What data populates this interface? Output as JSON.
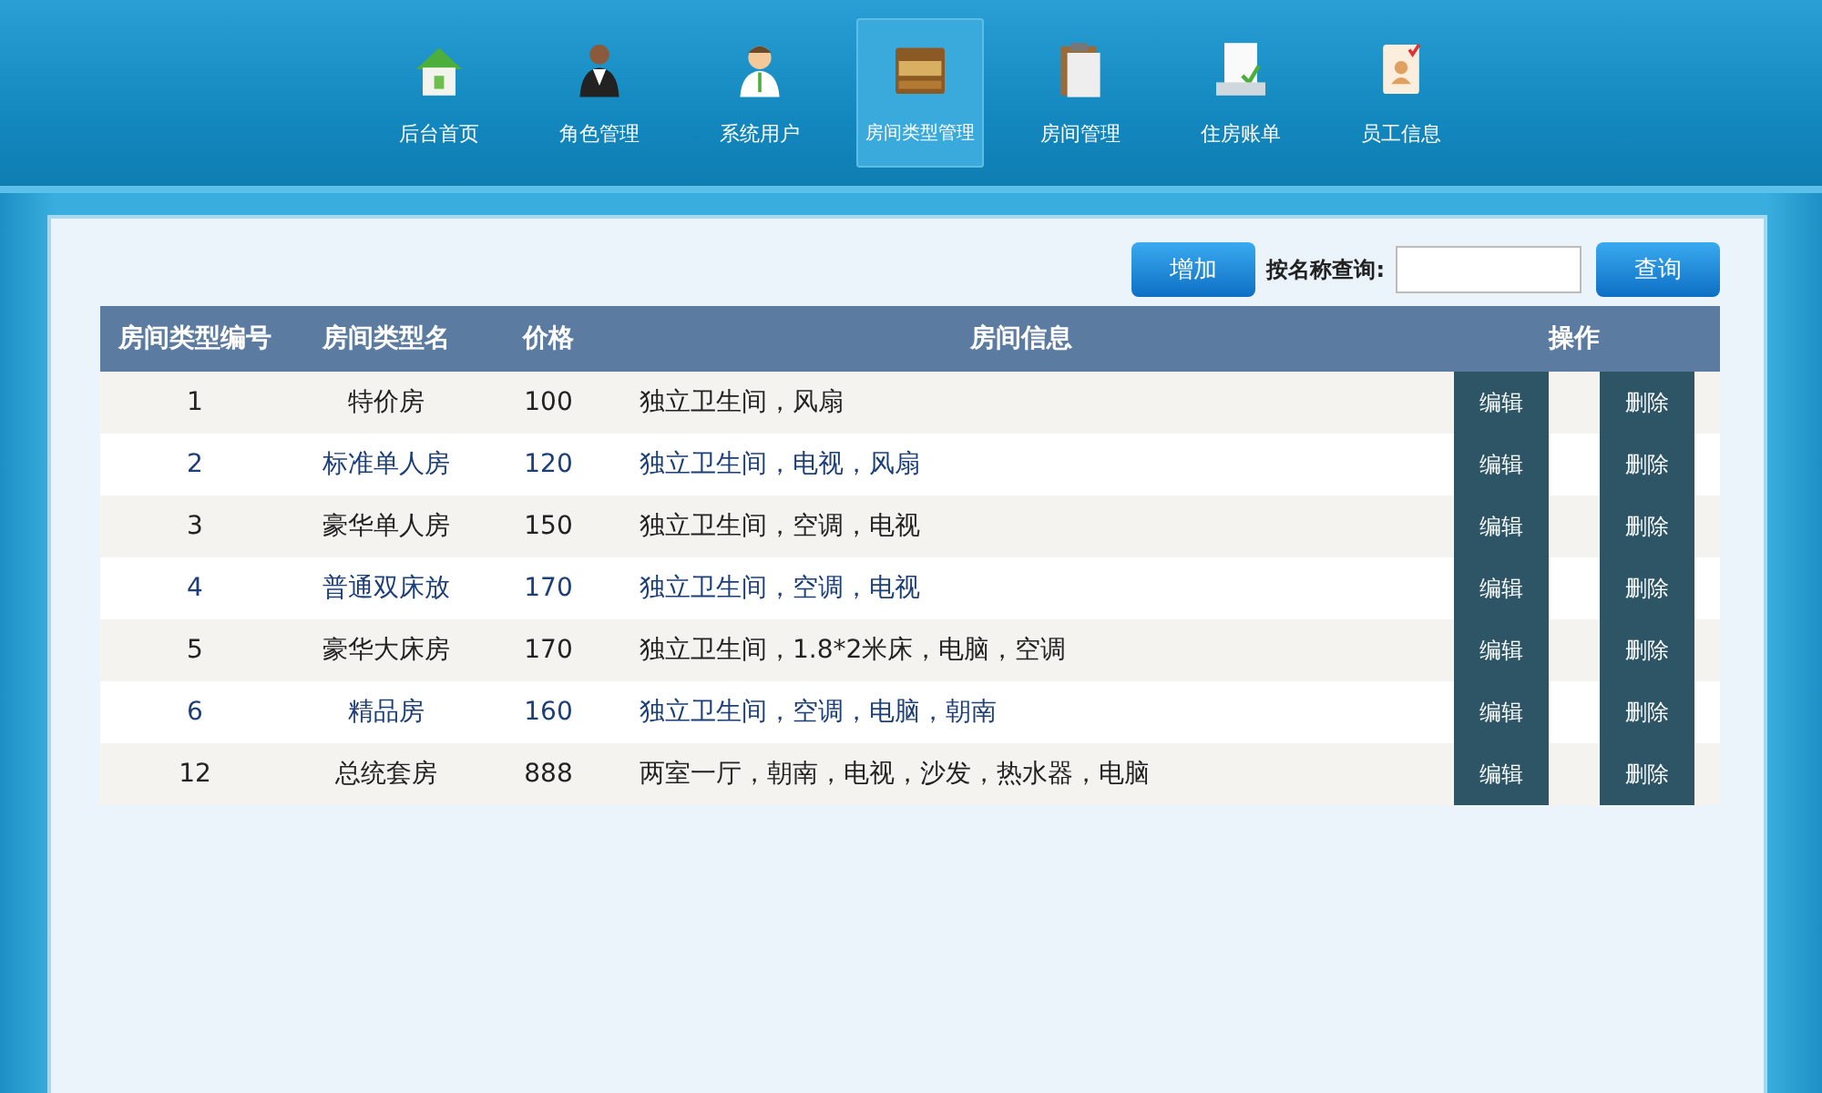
{
  "nav": [
    {
      "label": "后台首页",
      "selected": false
    },
    {
      "label": "角色管理",
      "selected": false
    },
    {
      "label": "系统用户",
      "selected": false
    },
    {
      "label": "房间类型管理",
      "selected": true
    },
    {
      "label": "房间管理",
      "selected": false
    },
    {
      "label": "住房账单",
      "selected": false
    },
    {
      "label": "员工信息",
      "selected": false
    }
  ],
  "toolbar": {
    "add_button": "增加",
    "search_label": "按名称查询:",
    "search_button": "查询"
  },
  "table": {
    "columns": [
      "房间类型编号",
      "房间类型名",
      "价格",
      "房间信息",
      "操作"
    ],
    "rows": [
      {
        "id": "1",
        "name": "特价房",
        "price": "100",
        "info": "独立卫生间，风扇",
        "edit": "编辑",
        "delete": "删除"
      },
      {
        "id": "2",
        "name": "标准单人房",
        "price": "120",
        "info": "独立卫生间，电视，风扇",
        "edit": "编辑",
        "delete": "删除"
      },
      {
        "id": "3",
        "name": "豪华单人房",
        "price": "150",
        "info": "独立卫生间，空调，电视",
        "edit": "编辑",
        "delete": "删除"
      },
      {
        "id": "4",
        "name": "普通双床放",
        "price": "170",
        "info": "独立卫生间，空调，电视",
        "edit": "编辑",
        "delete": "删除"
      },
      {
        "id": "5",
        "name": "豪华大床房",
        "price": "170",
        "info": "独立卫生间，1.8*2米床，电脑，空调",
        "edit": "编辑",
        "delete": "删除"
      },
      {
        "id": "6",
        "name": "精品房",
        "price": "160",
        "info": "独立卫生间，空调，电脑，朝南",
        "edit": "编辑",
        "delete": "删除"
      },
      {
        "id": "12",
        "name": "总统套房",
        "price": "888",
        "info": "两室一厅，朝南，电视，沙发，热水器，电脑",
        "edit": "编辑",
        "delete": "删除"
      }
    ]
  }
}
